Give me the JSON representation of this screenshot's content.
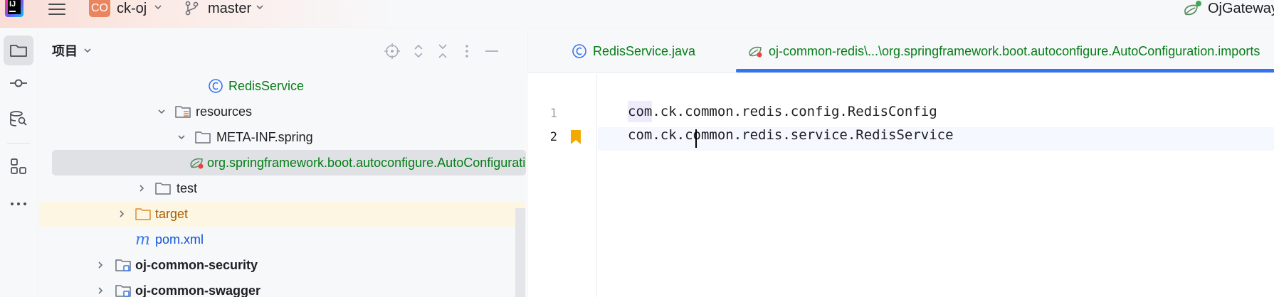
{
  "titlebar": {
    "app_logo_text": "IJ",
    "project_badge": "CO",
    "project_name": "ck-oj",
    "branch_name": "master",
    "run_config": "OjGateway"
  },
  "panel": {
    "title": "项目",
    "tree": [
      {
        "label": "RedisService",
        "icon": "class-icon",
        "style": "green"
      },
      {
        "label": "resources",
        "icon": "resources-folder-icon",
        "style": "normal"
      },
      {
        "label": "META-INF.spring",
        "icon": "folder-icon",
        "style": "normal"
      },
      {
        "label": "org.springframework.boot.autoconfigure.AutoConfiguration.imports",
        "icon": "spring-file-icon",
        "style": "green"
      },
      {
        "label": "test",
        "icon": "folder-icon",
        "style": "normal"
      },
      {
        "label": "target",
        "icon": "excluded-folder-icon",
        "style": "orange"
      },
      {
        "label": "pom.xml",
        "icon": "maven-icon",
        "style": "blue"
      },
      {
        "label": "oj-common-security",
        "icon": "module-icon",
        "style": "bold"
      },
      {
        "label": "oj-common-swagger",
        "icon": "module-icon",
        "style": "bold"
      }
    ]
  },
  "editor": {
    "tabs": [
      {
        "label": "RedisService.java",
        "icon": "class-icon"
      },
      {
        "label": "oj-common-redis\\...\\org.springframework.boot.autoconfigure.AutoConfiguration.imports",
        "icon": "spring-file-icon"
      }
    ],
    "line_numbers": [
      "1",
      "2"
    ],
    "lines": [
      "com.ck.common.redis.config.RedisConfig",
      "com.ck.common.redis.service.RedisService"
    ]
  },
  "colors": {
    "accent": "#3574f0",
    "green_text": "#067d17",
    "project_badge": "#e9855f",
    "bookmark": "#f2a900"
  }
}
